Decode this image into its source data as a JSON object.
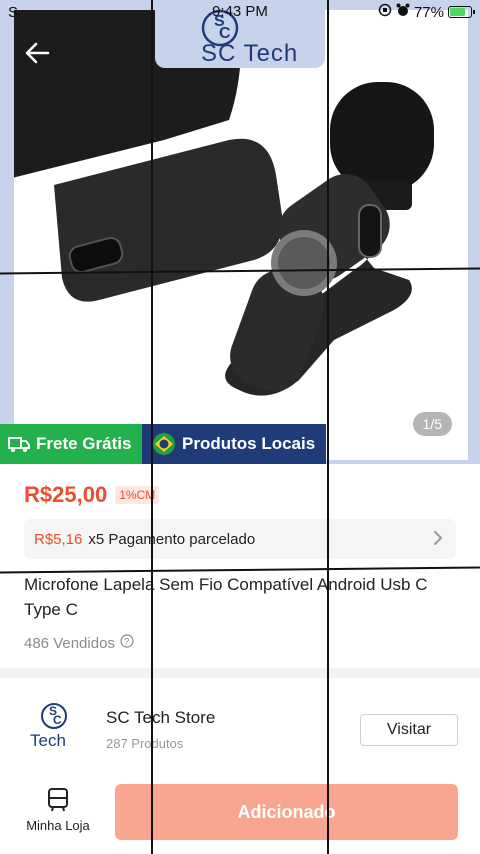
{
  "status_bar": {
    "carrier": "S",
    "time": "9:43 PM",
    "battery": "77%",
    "battery_level": 0.77
  },
  "product_image": {
    "brand_logo": "SC Tech",
    "photo_counter": "1/5",
    "tags": {
      "free_shipping": "Frete Grátis",
      "local_products": "Produtos Locais"
    }
  },
  "product": {
    "price": "R$25,00",
    "cm_badge": "1%CM",
    "installment_amount": "R$5,16",
    "installment_text": "x5 Pagamento parcelado",
    "title": "Microfone Lapela Sem Fio Compatível Android Usb C Type C",
    "sold": "486 Vendidos"
  },
  "store": {
    "name": "SC Tech Store",
    "product_count": "287 Produtos",
    "visit_label": "Visitar"
  },
  "bottom_bar": {
    "my_store_label": "Minha Loja",
    "add_button_label": "Adicionado"
  },
  "colors": {
    "accent": "#ee4d2d",
    "add_button": "#f8a68f",
    "free_shipping_tag": "#22b14c",
    "local_products_tag": "#1f3b78",
    "image_frame": "#c7d3ea"
  }
}
